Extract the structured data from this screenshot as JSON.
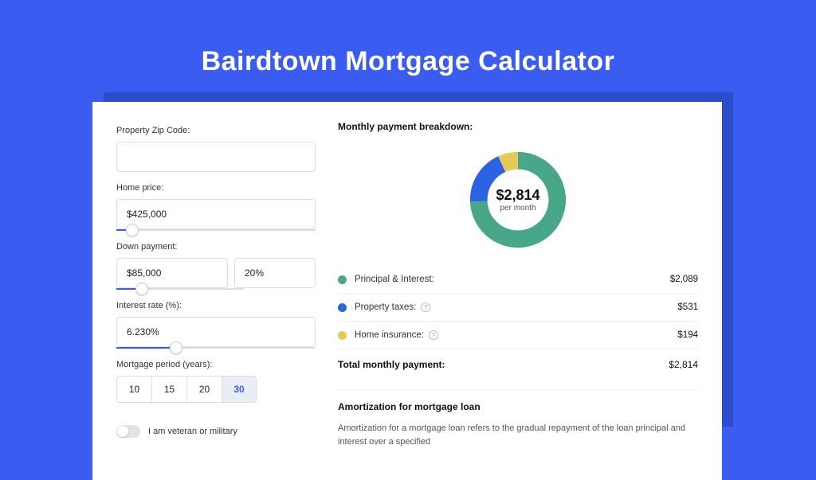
{
  "page_title": "Bairdtown Mortgage Calculator",
  "form": {
    "zip_label": "Property Zip Code:",
    "zip_value": "",
    "home_price_label": "Home price:",
    "home_price_value": "$425,000",
    "home_price_slider_pct": 8,
    "down_payment_label": "Down payment:",
    "down_payment_value": "$85,000",
    "down_payment_pct_value": "20%",
    "down_payment_slider_pct": 20,
    "interest_label": "Interest rate (%):",
    "interest_value": "6.230%",
    "interest_slider_pct": 30,
    "period_label": "Mortgage period (years):",
    "period_options": [
      "10",
      "15",
      "20",
      "30"
    ],
    "period_selected": "30",
    "veteran_label": "I am veteran or military",
    "veteran_on": false
  },
  "breakdown": {
    "title": "Monthly payment breakdown:",
    "center_amount": "$2,814",
    "center_sub": "per month",
    "items": [
      {
        "label": "Principal & Interest:",
        "value": "$2,089",
        "color": "green",
        "info": false
      },
      {
        "label": "Property taxes:",
        "value": "$531",
        "color": "blue",
        "info": true
      },
      {
        "label": "Home insurance:",
        "value": "$194",
        "color": "yellow",
        "info": true
      }
    ],
    "total_label": "Total monthly payment:",
    "total_value": "$2,814"
  },
  "amortization": {
    "title": "Amortization for mortgage loan",
    "text": "Amortization for a mortgage loan refers to the gradual repayment of the loan principal and interest over a specified"
  },
  "chart_data": {
    "type": "pie",
    "title": "Monthly payment breakdown",
    "series": [
      {
        "name": "Principal & Interest",
        "value": 2089,
        "color": "#48a789"
      },
      {
        "name": "Property taxes",
        "value": 531,
        "color": "#2b63e3"
      },
      {
        "name": "Home insurance",
        "value": 194,
        "color": "#e8c958"
      }
    ],
    "total": 2814,
    "center_label": "$2,814 per month"
  }
}
